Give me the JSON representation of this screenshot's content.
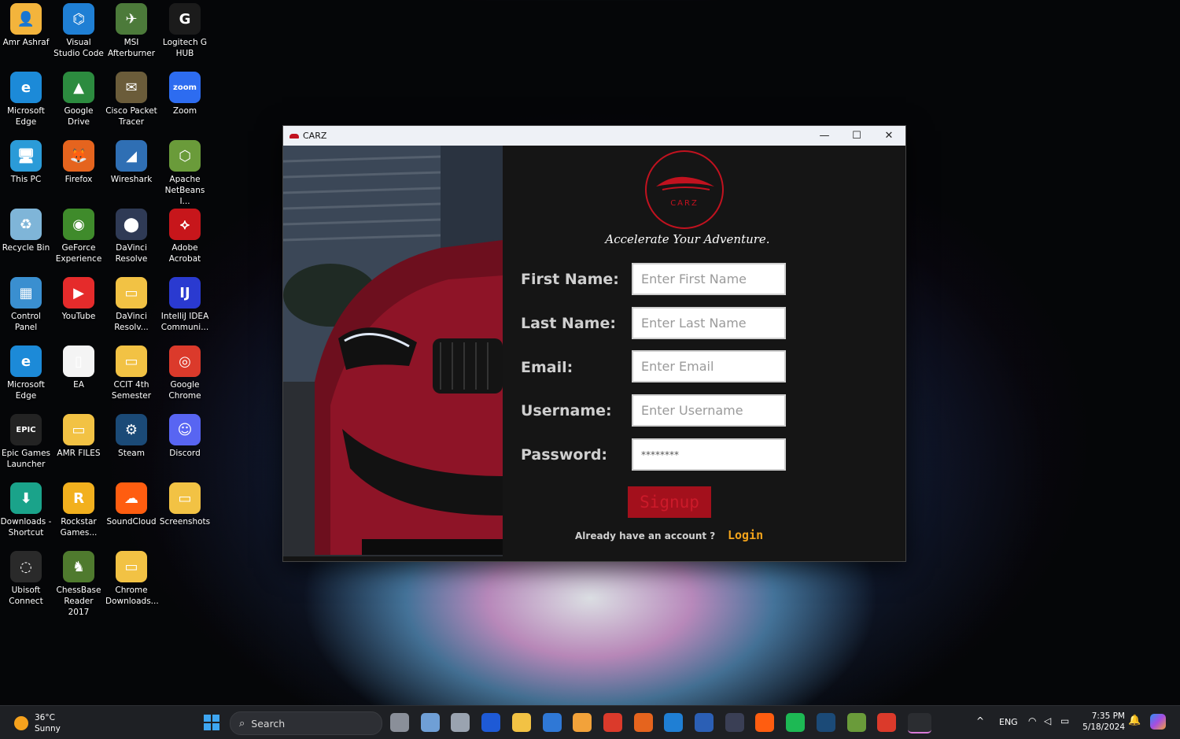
{
  "desktop": {
    "icons": [
      {
        "label": "Amr Ashraf",
        "color": "#f3b43c",
        "glyph": "👤"
      },
      {
        "label": "Visual Studio Code",
        "color": "#1f7fd4",
        "glyph": "⌬"
      },
      {
        "label": "MSI Afterburner",
        "color": "#4c7a3a",
        "glyph": "✈"
      },
      {
        "label": "Logitech G HUB",
        "color": "#1b1b1b",
        "glyph": "G"
      },
      {
        "label": "Microsoft Edge",
        "color": "#1c8ad8",
        "glyph": "e"
      },
      {
        "label": "Google Drive",
        "color": "#2c8b3f",
        "glyph": "▲"
      },
      {
        "label": "Cisco Packet Tracer",
        "color": "#6b5c3a",
        "glyph": "✉"
      },
      {
        "label": "Zoom",
        "color": "#2d6cf0",
        "glyph": "zoom"
      },
      {
        "label": "This PC",
        "color": "#2b9bd8",
        "glyph": "🖥"
      },
      {
        "label": "Firefox",
        "color": "#e5641e",
        "glyph": "🦊"
      },
      {
        "label": "Wireshark",
        "color": "#2f6fb4",
        "glyph": "◢"
      },
      {
        "label": "Apache NetBeans I...",
        "color": "#6a9b3a",
        "glyph": "⬡"
      },
      {
        "label": "Recycle Bin",
        "color": "#7fb5d8",
        "glyph": "♻"
      },
      {
        "label": "GeForce Experience",
        "color": "#3f8b2b",
        "glyph": "◉"
      },
      {
        "label": "DaVinci Resolve",
        "color": "#2f3a55",
        "glyph": "⬤"
      },
      {
        "label": "Adobe Acrobat",
        "color": "#c7161b",
        "glyph": "⟡"
      },
      {
        "label": "Control Panel",
        "color": "#3a8fd0",
        "glyph": "▦"
      },
      {
        "label": "YouTube",
        "color": "#e52b2b",
        "glyph": "▶"
      },
      {
        "label": "DaVinci Resolv...",
        "color": "#f2c244",
        "glyph": "▭"
      },
      {
        "label": "IntelliJ IDEA Communi...",
        "color": "#2a3ad0",
        "glyph": "IJ"
      },
      {
        "label": "Microsoft Edge",
        "color": "#1c8ad8",
        "glyph": "e"
      },
      {
        "label": "EA",
        "color": "#f4f4f4",
        "glyph": "▯"
      },
      {
        "label": "CCIT 4th Semester",
        "color": "#f2c244",
        "glyph": "▭"
      },
      {
        "label": "Google Chrome",
        "color": "#db3a2b",
        "glyph": "◎"
      },
      {
        "label": "Epic Games Launcher",
        "color": "#232323",
        "glyph": "EPIC"
      },
      {
        "label": "AMR FILES",
        "color": "#f2c244",
        "glyph": "▭"
      },
      {
        "label": "Steam",
        "color": "#1b4a77",
        "glyph": "⚙"
      },
      {
        "label": "Discord",
        "color": "#5865f2",
        "glyph": "☺"
      },
      {
        "label": "Downloads - Shortcut",
        "color": "#1aa38a",
        "glyph": "⬇"
      },
      {
        "label": "Rockstar Games...",
        "color": "#f2b01e",
        "glyph": "R"
      },
      {
        "label": "SoundCloud",
        "color": "#ff5d10",
        "glyph": "☁"
      },
      {
        "label": "Screenshots",
        "color": "#f2c244",
        "glyph": "▭"
      },
      {
        "label": "Ubisoft Connect",
        "color": "#2a2a2a",
        "glyph": "◌"
      },
      {
        "label": "ChessBase Reader 2017",
        "color": "#4f7a2e",
        "glyph": "♞"
      },
      {
        "label": "Chrome Downloads...",
        "color": "#f2c244",
        "glyph": "▭"
      }
    ]
  },
  "window": {
    "title": "CARZ",
    "minimize": "—",
    "maximize": "☐",
    "close": "✕",
    "logo_text": "CARZ",
    "tagline": "Accelerate Your Adventure.",
    "fields": [
      {
        "label": "First Name:",
        "placeholder": "Enter First Name",
        "value": ""
      },
      {
        "label": "Last Name:",
        "placeholder": "Enter Last Name",
        "value": ""
      },
      {
        "label": "Email:",
        "placeholder": "Enter Email",
        "value": ""
      },
      {
        "label": "Username:",
        "placeholder": "Enter Username",
        "value": ""
      },
      {
        "label": "Password:",
        "placeholder": "",
        "value": "********"
      }
    ],
    "signup_label": "Signup",
    "already_text": "Already have an account ?",
    "login_label": "Login"
  },
  "taskbar": {
    "weather_temp": "36°C",
    "weather_desc": "Sunny",
    "search_placeholder": "Search",
    "apps": [
      {
        "name": "task-view",
        "color": "#8a8f99"
      },
      {
        "name": "photos",
        "color": "#6f9fd6"
      },
      {
        "name": "settings",
        "color": "#9aa3b0"
      },
      {
        "name": "l-app",
        "color": "#1e5ad6"
      },
      {
        "name": "file-explorer",
        "color": "#f2c244"
      },
      {
        "name": "store",
        "color": "#2f78d6"
      },
      {
        "name": "packages",
        "color": "#f2a23a"
      },
      {
        "name": "chrome",
        "color": "#db3a2b"
      },
      {
        "name": "firefox",
        "color": "#e5641e"
      },
      {
        "name": "vscode",
        "color": "#1f7fd4"
      },
      {
        "name": "word",
        "color": "#2b5fb5"
      },
      {
        "name": "davinci",
        "color": "#3a3f55"
      },
      {
        "name": "soundcloud",
        "color": "#ff5d10"
      },
      {
        "name": "spotify",
        "color": "#1db954"
      },
      {
        "name": "steam",
        "color": "#1b4a77"
      },
      {
        "name": "netbeans",
        "color": "#6a9b3a"
      },
      {
        "name": "chrome-profile",
        "color": "#db3a2b"
      },
      {
        "name": "carz-app",
        "color": "#c1121f"
      }
    ],
    "tray_chevron": "^",
    "language": "ENG",
    "time": "7:35 PM",
    "date": "5/18/2024"
  }
}
